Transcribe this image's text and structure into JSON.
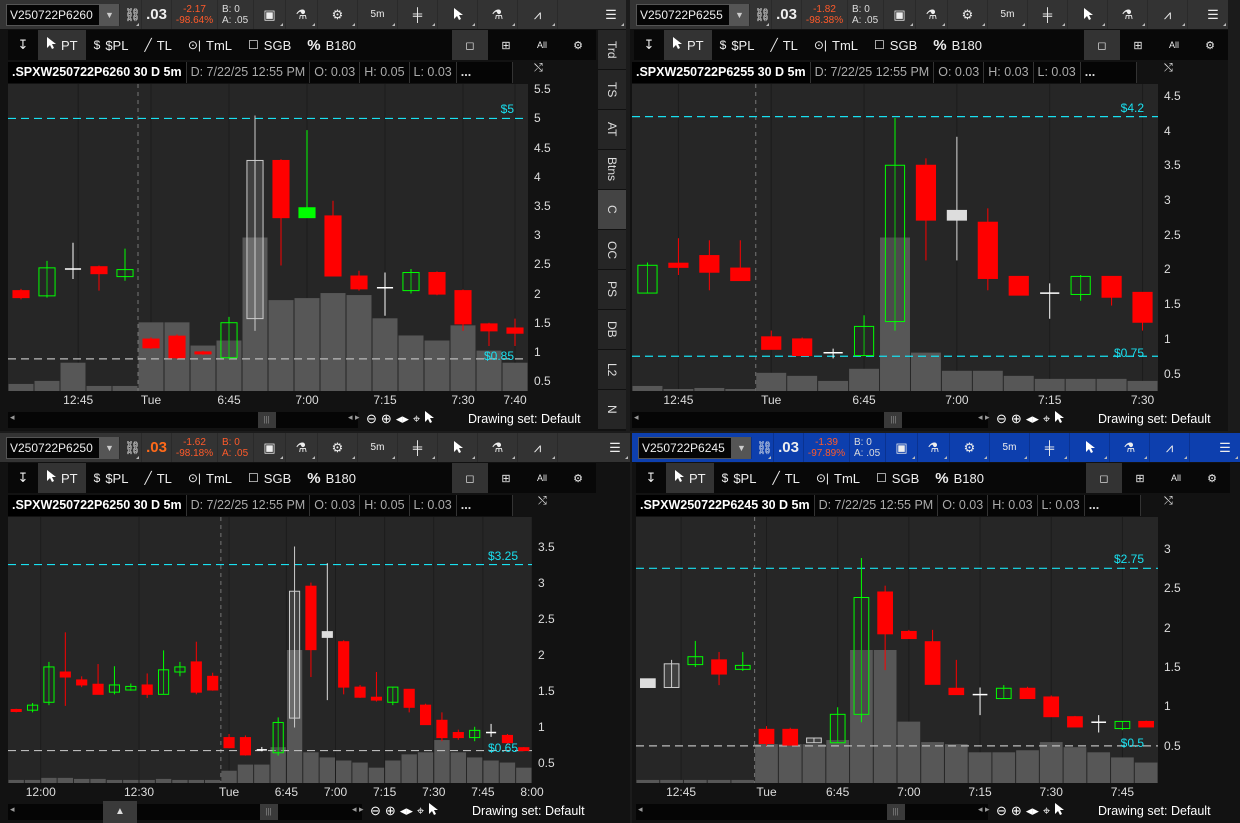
{
  "drawing_tools": [
    {
      "name": "pin",
      "label": ""
    },
    {
      "name": "pt",
      "label": "PT"
    },
    {
      "name": "spl",
      "label": "$PL"
    },
    {
      "name": "tl",
      "label": "TL"
    },
    {
      "name": "tml",
      "label": "TmL"
    },
    {
      "name": "sgb",
      "label": "SGB"
    },
    {
      "name": "b180",
      "label": "B180"
    }
  ],
  "layout_buttons": {
    "all_label": "All"
  },
  "side_tabs": [
    "Trd",
    "TS",
    "AT",
    "Btns",
    "C",
    "OC",
    "PS",
    "DB",
    "L2",
    "N"
  ],
  "side_tab_selected": "C",
  "panels": [
    {
      "symbol": "V250722P6260",
      "last": ".03",
      "last_highlight": false,
      "change": "-2.17",
      "change_pct": "-98.64%",
      "bid": "B: 0",
      "ask": "A: .05",
      "timeframe": "5m",
      "title": ".SPXW250722P6260 30 D 5m",
      "date": "D: 7/22/25 12:55 PM",
      "open": "O: 0.03",
      "high": "H: 0.05",
      "low": "L: 0.03",
      "more": "...",
      "drawing_set": "Drawing set: Default",
      "active": false,
      "chart_data": {
        "type": "candlestick",
        "ylim": [
          0.33,
          5.59
        ],
        "yticks": [
          "0.5",
          "1",
          "1.5",
          "2",
          "2.5",
          "3",
          "3.5",
          "4",
          "4.5",
          "5",
          "5.5"
        ],
        "candles": [
          [
            2.05,
            2.08,
            1.9,
            1.93,
            "down"
          ],
          [
            1.96,
            2.56,
            1.93,
            2.44,
            "up"
          ],
          [
            2.42,
            2.87,
            2.25,
            2.42,
            "doji"
          ],
          [
            2.46,
            2.48,
            2.05,
            2.34,
            "down"
          ],
          [
            2.29,
            2.77,
            2.22,
            2.41,
            "up"
          ],
          [
            1.22,
            1.25,
            1.05,
            1.07,
            "down"
          ],
          [
            1.27,
            1.3,
            0.88,
            0.9,
            "down"
          ],
          [
            1.0,
            1.02,
            0.95,
            0.97,
            "down"
          ],
          [
            0.9,
            1.6,
            0.88,
            1.5,
            "up"
          ],
          [
            1.57,
            5.05,
            1.36,
            4.28,
            "hollow"
          ],
          [
            4.28,
            4.3,
            2.48,
            3.3,
            "down"
          ],
          [
            3.3,
            4.8,
            3.3,
            3.47,
            "upfill"
          ],
          [
            3.33,
            3.59,
            2.3,
            2.3,
            "down"
          ],
          [
            2.3,
            2.39,
            2.05,
            2.08,
            "down"
          ],
          [
            2.1,
            2.36,
            1.62,
            2.1,
            "doji"
          ],
          [
            2.05,
            2.42,
            2.0,
            2.36,
            "up"
          ],
          [
            2.36,
            2.38,
            1.97,
            1.99,
            "down"
          ],
          [
            2.05,
            2.07,
            1.36,
            1.48,
            "down"
          ],
          [
            1.48,
            1.5,
            1.1,
            1.36,
            "down"
          ],
          [
            1.41,
            1.57,
            1.1,
            1.32,
            "down"
          ]
        ],
        "volume": [
          7,
          10,
          28,
          5,
          5,
          68,
          68,
          45,
          50,
          152,
          90,
          92,
          97,
          95,
          72,
          55,
          50,
          65,
          40,
          28
        ],
        "price_lines": [
          {
            "label": "$5",
            "value": 5,
            "color": "#19e0f0"
          },
          {
            "label": "$0.85",
            "value": 0.88,
            "color": "#bbbbbb"
          }
        ],
        "day_break": 5,
        "time_ticks": [
          {
            "label": "12:45",
            "slot": 2.2
          },
          {
            "label": "Tue",
            "slot": 5
          },
          {
            "label": "6:45",
            "slot": 8
          },
          {
            "label": "7:00",
            "slot": 11
          },
          {
            "label": "7:15",
            "slot": 14
          },
          {
            "label": "7:30",
            "slot": 17
          },
          {
            "label": "7:40",
            "slot": 19
          }
        ]
      }
    },
    {
      "symbol": "V250722P6255",
      "last": ".03",
      "last_highlight": false,
      "change": "-1.82",
      "change_pct": "-98.38%",
      "bid": "B: 0",
      "ask": "A: .05",
      "timeframe": "5m",
      "title": ".SPXW250722P6255 30 D 5m",
      "date": "D: 7/22/25 12:55 PM",
      "open": "O: 0.03",
      "high": "H: 0.03",
      "low": "L: 0.03",
      "more": "...",
      "drawing_set": "Drawing set: Default",
      "active": false,
      "chart_data": {
        "type": "candlestick",
        "ylim": [
          0.25,
          4.67
        ],
        "yticks": [
          "0.5",
          "1",
          "1.5",
          "2",
          "2.5",
          "3",
          "3.5",
          "4",
          "4.5"
        ],
        "candles": [
          [
            1.66,
            2.1,
            1.66,
            2.06,
            "up"
          ],
          [
            2.09,
            2.45,
            1.92,
            2.03,
            "down"
          ],
          [
            2.2,
            2.42,
            1.7,
            1.96,
            "down"
          ],
          [
            2.02,
            2.42,
            1.84,
            1.84,
            "down"
          ],
          [
            1.03,
            1.12,
            0.85,
            0.85,
            "down"
          ],
          [
            1.0,
            1.02,
            0.76,
            0.76,
            "down"
          ],
          [
            0.8,
            0.86,
            0.72,
            0.8,
            "doji"
          ],
          [
            0.76,
            1.34,
            0.76,
            1.18,
            "up"
          ],
          [
            1.25,
            4.18,
            1.12,
            3.5,
            "up"
          ],
          [
            3.5,
            3.6,
            2.13,
            2.71,
            "down"
          ],
          [
            2.71,
            3.91,
            2.13,
            2.85,
            "wfill"
          ],
          [
            2.68,
            2.88,
            1.7,
            1.87,
            "down"
          ],
          [
            1.9,
            1.9,
            1.63,
            1.63,
            "down"
          ],
          [
            1.66,
            1.8,
            1.29,
            1.66,
            "doji"
          ],
          [
            1.64,
            1.92,
            1.55,
            1.9,
            "up"
          ],
          [
            1.9,
            1.9,
            1.48,
            1.6,
            "down"
          ],
          [
            1.67,
            1.67,
            1.12,
            1.24,
            "down"
          ]
        ],
        "volume": [
          5,
          2,
          3,
          2,
          18,
          15,
          10,
          22,
          152,
          38,
          20,
          20,
          15,
          12,
          12,
          12,
          10
        ],
        "price_lines": [
          {
            "label": "$4.2",
            "value": 4.2,
            "color": "#19e0f0"
          },
          {
            "label": "$0.75",
            "value": 0.75,
            "color": "#19e0f0"
          }
        ],
        "day_break": 4,
        "time_ticks": [
          {
            "label": "12:45",
            "slot": 1
          },
          {
            "label": "Tue",
            "slot": 4
          },
          {
            "label": "6:45",
            "slot": 7
          },
          {
            "label": "7:00",
            "slot": 10
          },
          {
            "label": "7:15",
            "slot": 13
          },
          {
            "label": "7:30",
            "slot": 16
          }
        ]
      }
    },
    {
      "symbol": "V250722P6250",
      "last": ".03",
      "last_highlight": true,
      "change": "-1.62",
      "change_pct": "-98.18%",
      "bid": "B: 0",
      "ask": "A: .05",
      "timeframe": "5m",
      "title": ".SPXW250722P6250 30 D 5m",
      "date": "D: 7/22/25 12:55 PM",
      "open": "O: 0.03",
      "high": "H: 0.05",
      "low": "L: 0.03",
      "more": "...",
      "drawing_set": "Drawing set: Default",
      "active": false,
      "chart_data": {
        "type": "candlestick",
        "ylim": [
          0.22,
          3.91
        ],
        "yticks": [
          "0.5",
          "1",
          "1.5",
          "2",
          "2.5",
          "3",
          "3.5"
        ],
        "candles": [
          [
            1.24,
            1.25,
            1.2,
            1.22,
            "down"
          ],
          [
            1.23,
            1.33,
            1.2,
            1.3,
            "up"
          ],
          [
            1.34,
            1.9,
            1.3,
            1.83,
            "up"
          ],
          [
            1.76,
            2.31,
            1.29,
            1.69,
            "down"
          ],
          [
            1.65,
            1.7,
            1.55,
            1.58,
            "down"
          ],
          [
            1.59,
            1.87,
            1.45,
            1.45,
            "down"
          ],
          [
            1.48,
            1.84,
            1.45,
            1.58,
            "up"
          ],
          [
            1.51,
            1.6,
            1.5,
            1.56,
            "up"
          ],
          [
            1.58,
            1.74,
            1.4,
            1.45,
            "down"
          ],
          [
            1.45,
            2.06,
            1.45,
            1.79,
            "up"
          ],
          [
            1.76,
            1.9,
            1.7,
            1.83,
            "up"
          ],
          [
            1.9,
            2.18,
            1.45,
            1.48,
            "down"
          ],
          [
            1.7,
            1.75,
            1.5,
            1.51,
            "down"
          ],
          [
            0.85,
            0.9,
            0.7,
            0.71,
            "down"
          ],
          [
            0.85,
            0.88,
            0.6,
            0.61,
            "down"
          ],
          [
            0.68,
            0.72,
            0.66,
            0.68,
            "doji"
          ],
          [
            0.64,
            1.13,
            0.6,
            1.06,
            "up"
          ],
          [
            1.12,
            3.5,
            0.99,
            2.88,
            "hollow"
          ],
          [
            2.95,
            3.0,
            1.69,
            2.07,
            "down"
          ],
          [
            2.24,
            3.27,
            1.37,
            2.32,
            "wfill"
          ],
          [
            2.18,
            2.2,
            1.45,
            1.55,
            "down"
          ],
          [
            1.55,
            1.58,
            1.4,
            1.41,
            "down"
          ],
          [
            1.41,
            1.76,
            1.35,
            1.37,
            "down"
          ],
          [
            1.34,
            1.55,
            1.3,
            1.55,
            "up"
          ],
          [
            1.52,
            1.52,
            1.2,
            1.27,
            "down"
          ],
          [
            1.3,
            1.32,
            1.03,
            1.03,
            "down"
          ],
          [
            1.09,
            1.2,
            0.8,
            0.85,
            "down"
          ],
          [
            0.92,
            0.96,
            0.82,
            0.85,
            "down"
          ],
          [
            0.85,
            1.0,
            0.8,
            0.95,
            "up"
          ],
          [
            0.92,
            1.04,
            0.86,
            0.92,
            "doji"
          ],
          [
            0.88,
            0.9,
            0.75,
            0.78,
            "down"
          ],
          [
            0.71,
            0.72,
            0.66,
            0.67,
            "down"
          ]
        ],
        "volume": [
          3,
          3,
          5,
          5,
          4,
          4,
          3,
          3,
          3,
          4,
          3,
          3,
          3,
          12,
          18,
          18,
          35,
          130,
          30,
          25,
          22,
          20,
          15,
          22,
          28,
          30,
          42,
          30,
          25,
          22,
          20,
          15
        ],
        "price_lines": [
          {
            "label": "$3.25",
            "value": 3.25,
            "color": "#19e0f0"
          },
          {
            "label": "$0.65",
            "value": 0.67,
            "color": "#bbbbbb"
          }
        ],
        "day_break": 13,
        "time_ticks": [
          {
            "label": "12:00",
            "slot": 1.5
          },
          {
            "label": "12:30",
            "slot": 7.5
          },
          {
            "label": "Tue",
            "slot": 13
          },
          {
            "label": "6:45",
            "slot": 16.5
          },
          {
            "label": "7:00",
            "slot": 19.5
          },
          {
            "label": "7:15",
            "slot": 22.5
          },
          {
            "label": "7:30",
            "slot": 25.5
          },
          {
            "label": "7:45",
            "slot": 28.5
          },
          {
            "label": "8:00",
            "slot": 31.5
          }
        ]
      }
    },
    {
      "symbol": "V250722P6245",
      "last": ".03",
      "last_highlight": false,
      "change": "-1.39",
      "change_pct": "-97.89%",
      "bid": "B: 0",
      "ask": "A: .05",
      "timeframe": "5m",
      "title": ".SPXW250722P6245 30 D 5m",
      "date": "D: 7/22/25 12:55 PM",
      "open": "O: 0.03",
      "high": "H: 0.03",
      "low": "L: 0.03",
      "more": "...",
      "drawing_set": "Drawing set: Default",
      "active": true,
      "chart_data": {
        "type": "candlestick",
        "ylim": [
          0.03,
          3.4
        ],
        "yticks": [
          "0.5",
          "1",
          "1.5",
          "2",
          "2.5",
          "3"
        ],
        "candles": [
          [
            1.24,
            1.35,
            1.24,
            1.35,
            "wfill"
          ],
          [
            1.24,
            1.59,
            1.24,
            1.54,
            "hollow"
          ],
          [
            1.53,
            1.83,
            1.5,
            1.63,
            "up"
          ],
          [
            1.59,
            1.69,
            1.27,
            1.41,
            "down"
          ],
          [
            1.47,
            1.69,
            1.45,
            1.52,
            "up"
          ],
          [
            0.71,
            0.75,
            0.5,
            0.53,
            "down"
          ],
          [
            0.71,
            0.73,
            0.51,
            0.51,
            "down"
          ],
          [
            0.54,
            0.6,
            0.54,
            0.6,
            "hollow"
          ],
          [
            0.54,
            0.99,
            0.54,
            0.9,
            "up"
          ],
          [
            0.9,
            2.88,
            0.8,
            2.38,
            "up"
          ],
          [
            2.45,
            2.53,
            1.46,
            1.92,
            "down"
          ],
          [
            1.95,
            1.97,
            1.86,
            1.86,
            "down"
          ],
          [
            1.82,
            1.97,
            1.28,
            1.28,
            "down"
          ],
          [
            1.23,
            1.59,
            1.15,
            1.15,
            "down"
          ],
          [
            1.15,
            1.24,
            0.89,
            1.15,
            "doji"
          ],
          [
            1.1,
            1.27,
            1.1,
            1.23,
            "up"
          ],
          [
            1.23,
            1.25,
            1.1,
            1.1,
            "down"
          ],
          [
            1.12,
            1.14,
            0.87,
            0.87,
            "down"
          ],
          [
            0.87,
            0.88,
            0.74,
            0.74,
            "down"
          ],
          [
            0.8,
            0.89,
            0.67,
            0.8,
            "doji"
          ],
          [
            0.72,
            0.81,
            0.7,
            0.81,
            "up"
          ],
          [
            0.81,
            0.82,
            0.74,
            0.74,
            "down"
          ]
        ],
        "volume": [
          3,
          3,
          3,
          3,
          3,
          38,
          38,
          38,
          42,
          130,
          130,
          60,
          40,
          38,
          30,
          30,
          32,
          40,
          35,
          30,
          25,
          20
        ],
        "price_lines": [
          {
            "label": "$2.75",
            "value": 2.75,
            "color": "#19e0f0"
          },
          {
            "label": "$0.5",
            "value": 0.5,
            "color": "#bbbbbb"
          }
        ],
        "day_break": 5,
        "time_ticks": [
          {
            "label": "12:45",
            "slot": 1.4
          },
          {
            "label": "Tue",
            "slot": 5
          },
          {
            "label": "6:45",
            "slot": 8
          },
          {
            "label": "7:00",
            "slot": 11
          },
          {
            "label": "7:15",
            "slot": 14
          },
          {
            "label": "7:30",
            "slot": 17
          },
          {
            "label": "7:45",
            "slot": 20
          }
        ]
      }
    }
  ]
}
